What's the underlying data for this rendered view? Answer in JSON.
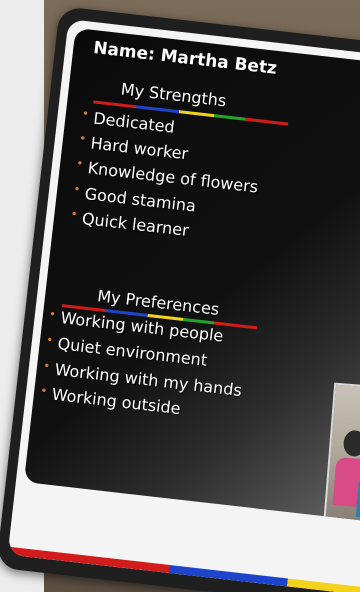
{
  "card": {
    "name_line": "Name: Martha Betz",
    "strengths": {
      "title": "My Strengths",
      "items": [
        "Dedicated",
        "Hard worker",
        "Knowledge of flowers",
        "Good stamina",
        "Quick learner"
      ]
    },
    "preferences": {
      "title": "My Preferences",
      "items": [
        "Working with people",
        "Quiet environment",
        "Working with my hands",
        "Working outside"
      ]
    }
  },
  "colors": {
    "board_frame": "#1f1f1f",
    "background_wall": "#7b6b59",
    "accent_red": "#d21b1b",
    "accent_blue": "#1f44cc",
    "accent_yellow": "#f2d21a",
    "accent_green": "#24a52a",
    "bullet": "#d07a2a"
  }
}
